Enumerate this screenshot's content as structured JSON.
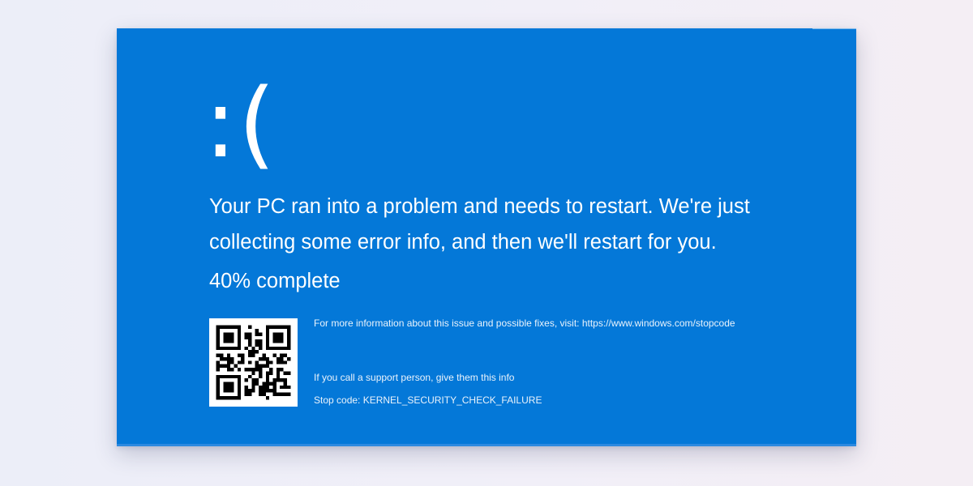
{
  "screen": {
    "background_color": "#0478d8",
    "sad_face": ":(",
    "message": "Your PC ran into a problem and needs to restart. We're just collecting some error info, and then we'll restart for you.",
    "progress": {
      "percent": 40,
      "percent_label": "40%",
      "suffix": "complete"
    },
    "qr_code": {
      "icon": "qr-code"
    },
    "more_info": "For more information about this issue and possible fixes, visit: https://www.windows.com/stopcode",
    "support_text": "If you call a support person, give them this info",
    "stop_code_line": "Stop code: KERNEL_SECURITY_CHECK_FAILURE"
  }
}
